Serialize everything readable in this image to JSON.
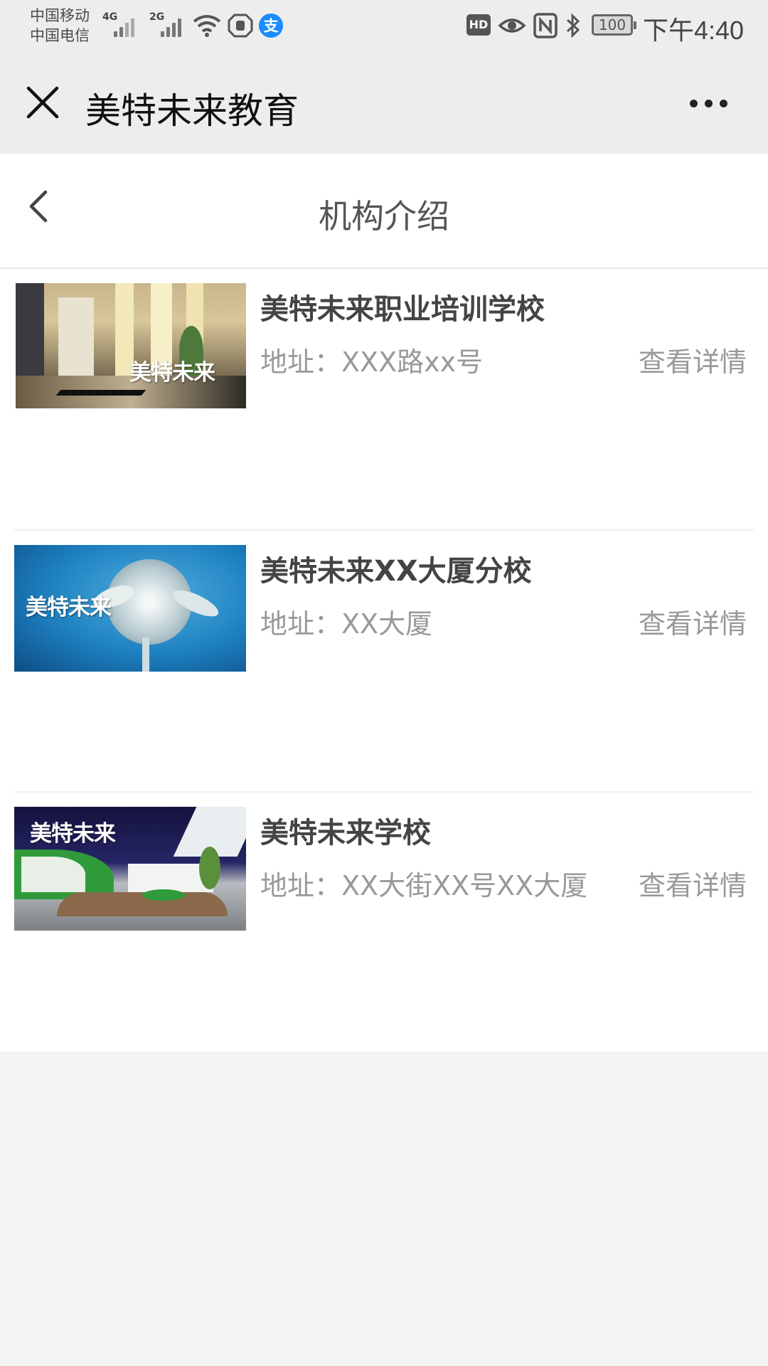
{
  "status_bar": {
    "carrier_1": "中国移动",
    "carrier_2": "中国电信",
    "signal_1_tag": "4G",
    "signal_2_tag": "2G",
    "hd_label": "HD",
    "battery": "100",
    "time": "下午4:40"
  },
  "top_bar": {
    "title": "美特未来教育",
    "close_icon": "close-icon",
    "more_icon": "more-icon"
  },
  "page": {
    "title": "机构介绍",
    "back_icon": "chevron-left-icon"
  },
  "institutions": [
    {
      "name": "美特未来职业培训学校",
      "address": "地址：XXX路xx号",
      "detail_link": "查看详情",
      "thumb_text": "美特未来"
    },
    {
      "name": "美特未来XX大厦分校",
      "address": "地址：XX大厦",
      "detail_link": "查看详情",
      "thumb_text": "美特未来"
    },
    {
      "name": "美特未来学校",
      "address": "地址：XX大街XX号XX大厦",
      "detail_link": "查看详情",
      "thumb_text": "美特未来"
    }
  ],
  "colors": {
    "chrome_bg": "#ededed",
    "page_bg": "#ffffff",
    "footer_bg": "#f3f3f3",
    "alipay_blue": "#1a8cff"
  }
}
